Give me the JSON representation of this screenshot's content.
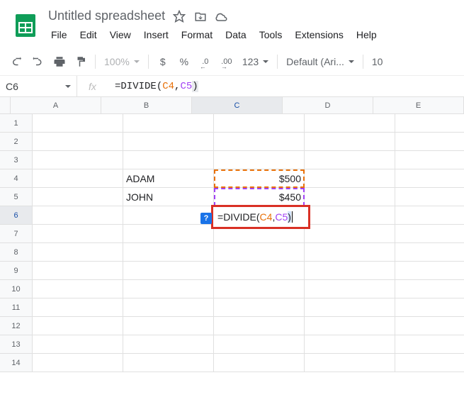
{
  "header": {
    "title": "Untitled spreadsheet"
  },
  "menu": {
    "file": "File",
    "edit": "Edit",
    "view": "View",
    "insert": "Insert",
    "format": "Format",
    "data": "Data",
    "tools": "Tools",
    "extensions": "Extensions",
    "help": "Help"
  },
  "toolbar": {
    "zoom": "100%",
    "currency": "$",
    "percent": "%",
    "dec_dec": ".0",
    "inc_dec": ".00",
    "num_format": "123",
    "font": "Default (Ari...",
    "font_size": "10"
  },
  "namebox": {
    "cell": "C6"
  },
  "fx_label": "fx",
  "formula": {
    "eq": "=",
    "fn": "DIVIDE",
    "open": "(",
    "ref1": "C4",
    "comma": ",",
    "ref2": "C5",
    "close": ")"
  },
  "columns": {
    "A": "A",
    "B": "B",
    "C": "C",
    "D": "D",
    "E": "E"
  },
  "rows": [
    "1",
    "2",
    "3",
    "4",
    "5",
    "6",
    "7",
    "8",
    "9",
    "10",
    "11",
    "12",
    "13",
    "14"
  ],
  "cells": {
    "B4": "ADAM",
    "B5": "JOHN",
    "C4": "$500",
    "C5": "$450"
  },
  "help_badge": "?"
}
